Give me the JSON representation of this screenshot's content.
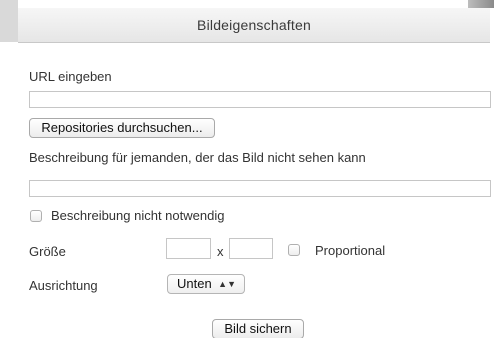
{
  "dialog": {
    "title": "Bildeigenschaften"
  },
  "url": {
    "label": "URL eingeben",
    "value": ""
  },
  "repositories_button": "Repositories durchsuchen...",
  "description": {
    "label": "Beschreibung für jemanden, der das Bild nicht sehen kann",
    "value": ""
  },
  "description_not_needed": {
    "label": "Beschreibung nicht notwendig",
    "checked": false
  },
  "size": {
    "label": "Größe",
    "width": "",
    "height": "",
    "separator": "x",
    "proportional_label": "Proportional",
    "proportional_checked": false
  },
  "alignment": {
    "label": "Ausrichtung",
    "selected": "Unten"
  },
  "save_button": "Bild sichern"
}
